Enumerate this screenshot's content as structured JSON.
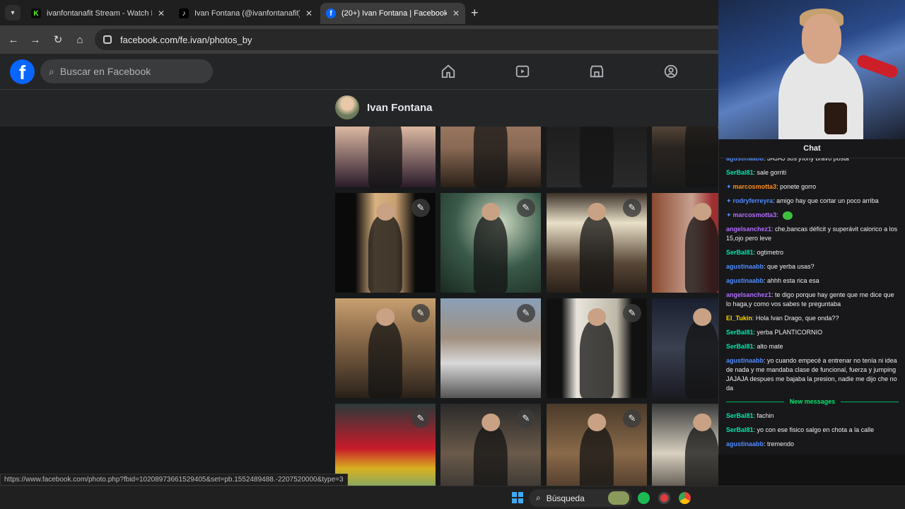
{
  "browser": {
    "tabs": [
      {
        "title": "ivanfontanafit Stream - Watch Live",
        "favicon": "kick-icon",
        "color": "#53fc18",
        "glyph": "K"
      },
      {
        "title": "Ivan Fontana (@ivanfontanafit) est",
        "favicon": "tiktok-icon",
        "color": "#000000",
        "glyph": "♪"
      },
      {
        "title": "(20+) Ivan Fontana | Facebook",
        "favicon": "facebook-icon",
        "color": "#0866ff",
        "glyph": "f"
      }
    ],
    "url": "facebook.com/fe.ivan/photos_by",
    "status_url": "https://www.facebook.com/photo.php?fbid=10208973661529405&set=pb.1552489488.-2207520000&type=3"
  },
  "facebook": {
    "logo": "f",
    "search_placeholder": "Buscar en Facebook",
    "nav": [
      "home-icon",
      "watch-icon",
      "marketplace-icon",
      "groups-icon"
    ],
    "profile_name": "Ivan Fontana"
  },
  "photos": [
    {
      "bg": "linear-gradient(180deg,#6b7a8e,#d9b6a0 40%,#2a1a2a)",
      "edit": false
    },
    {
      "bg": "linear-gradient(180deg,#b08a70,#8a6a55 60%,#2a2018)",
      "edit": false
    },
    {
      "bg": "linear-gradient(180deg,#c9c4b8,#1e1e1e 40%,#2a2a2a)",
      "edit": false
    },
    {
      "bg": "linear-gradient(180deg,#a08060,#2a2420 60%,#1a1a1a)",
      "edit": false
    },
    {
      "bg": "linear-gradient(90deg,#0a0a0a 20%,#d9b280 40%,#c9a070 60%,#0a0a0a 80%)",
      "edit": true
    },
    {
      "bg": "radial-gradient(circle at 60% 30%,#c9d8c0,#3a5a4a 50%,#1a2a20)",
      "edit": true
    },
    {
      "bg": "linear-gradient(180deg,#3a3028,#e9e0c8 30%,#5a4838 70%,#2a2018)",
      "edit": true
    },
    {
      "bg": "linear-gradient(90deg,#8a4a30,#c8a090 40%,#a03030 60%,#6a3020)",
      "edit": true
    },
    {
      "bg": "linear-gradient(180deg,#c8a070,#8a6a4a 40%,#4a3a2a 80%,#2a2018)",
      "edit": true
    },
    {
      "bg": "linear-gradient(180deg,#8aa0b8,#a09080 40%,#d8d8d8 65%,#555 100%)",
      "edit": true
    },
    {
      "bg": "linear-gradient(90deg,#111 15%,#e8e4dc 30%,#bdb8a8 70%,#111 85%)",
      "edit": true
    },
    {
      "bg": "linear-gradient(180deg,#1a2030,#3a4050 50%,#1a1a22)",
      "edit": true
    },
    {
      "bg": "linear-gradient(180deg,#2a3a3a,#c81a2a 45%,#d8b020 65%,#3aa0a0)",
      "edit": true
    },
    {
      "bg": "linear-gradient(180deg,#2a2a2a,#6a5a4a 50%,#2a2a2a)",
      "edit": true
    },
    {
      "bg": "linear-gradient(180deg,#4a3a2a,#8a6a4a 50%,#3a2a20)",
      "edit": true
    },
    {
      "bg": "linear-gradient(180deg,#3a3a3a,#d8d0c0 50%,#2a2420)",
      "edit": false
    }
  ],
  "stream": {
    "chat_title": "Chat",
    "new_messages_label": "New messages",
    "messages": [
      {
        "user": "agustinaabb",
        "color": "#4f8cff",
        "badge": false,
        "text": "JAJAJ sos jnony bravo posta"
      },
      {
        "user": "SerBal81",
        "color": "#00e8a8",
        "badge": false,
        "text": "sale gorriti"
      },
      {
        "user": "marcosmotta3",
        "color": "#ff8c1a",
        "badge": true,
        "text": "ponete gorro"
      },
      {
        "user": "rodryferreyra",
        "color": "#4f8cff",
        "badge": true,
        "text": "amigo hay que cortar un poco arriba"
      },
      {
        "user": "marcosmotta3",
        "color": "#b26bff",
        "badge": true,
        "text": "",
        "emote": true
      },
      {
        "user": "angelsanchez1",
        "color": "#b26bff",
        "badge": false,
        "text": "che,bancas déficit y superávit calorico a los 15,ojo pero leve"
      },
      {
        "user": "SerBal81",
        "color": "#00e8a8",
        "badge": false,
        "text": "ogtimetro"
      },
      {
        "user": "agustinaabb",
        "color": "#4f8cff",
        "badge": false,
        "text": "que yerba usas?"
      },
      {
        "user": "agustinaabb",
        "color": "#4f8cff",
        "badge": false,
        "text": "ahhh esta rica esa"
      },
      {
        "user": "angelsanchez1",
        "color": "#b26bff",
        "badge": false,
        "text": "te digo porque hay gente que me dice que lo haga,y como vos sabes te preguntaba"
      },
      {
        "user": "El_Tukin",
        "color": "#ffd400",
        "badge": false,
        "text": "Hola Ivan Drago, que onda??"
      },
      {
        "user": "SerBal81",
        "color": "#00e8a8",
        "badge": false,
        "text": "yerba PLANTICORNIO"
      },
      {
        "user": "SerBal81",
        "color": "#00e8a8",
        "badge": false,
        "text": "alto mate"
      },
      {
        "user": "agustinaabb",
        "color": "#4f8cff",
        "badge": false,
        "text": "yo cuando empecé a entrenar no tenía ni idea de nada y me mandaba clase de funcional, fuerza y jumping JAJAJA despues me bajaba la presion, nadie me dijo che no da"
      }
    ],
    "new_messages": [
      {
        "user": "SerBal81",
        "color": "#00e8a8",
        "badge": false,
        "text": "fachin"
      },
      {
        "user": "SerBal81",
        "color": "#00e8a8",
        "badge": false,
        "text": "yo con ese fisico salgo en chota a la calle"
      },
      {
        "user": "agustinaabb",
        "color": "#4f8cff",
        "badge": false,
        "text": "tremendo"
      }
    ]
  },
  "taskbar": {
    "search_label": "Búsqueda",
    "apps": [
      "windows-start-icon",
      "spotify-icon",
      "recorder-icon",
      "chrome-icon"
    ]
  }
}
